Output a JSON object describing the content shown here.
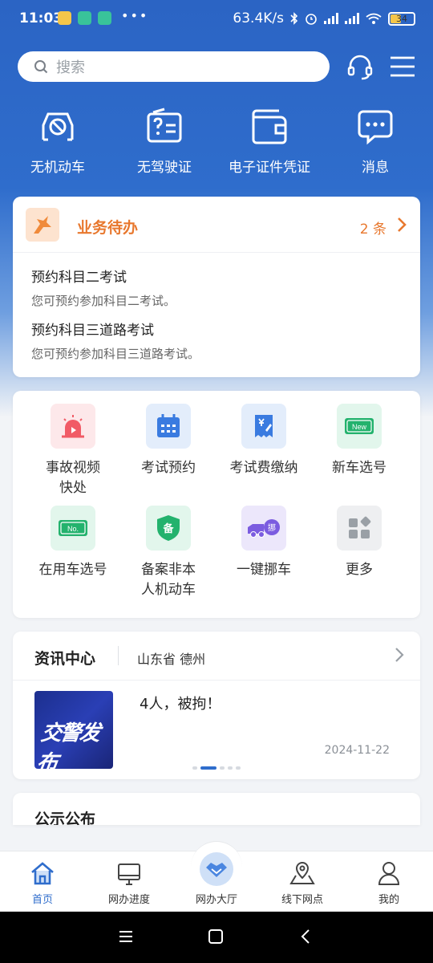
{
  "status_bar": {
    "time": "11:03",
    "more": "•••",
    "net_speed": "63.4K/s",
    "battery": "34"
  },
  "header": {
    "search_placeholder": "搜索"
  },
  "quick_actions": [
    {
      "label": "无机动车",
      "icon": "car-ban-icon"
    },
    {
      "label": "无驾驶证",
      "icon": "license-card-icon"
    },
    {
      "label": "电子证件凭证",
      "icon": "wallet-icon"
    },
    {
      "label": "消息",
      "icon": "message-icon"
    }
  ],
  "todo": {
    "title": "业务待办",
    "count": "2 条",
    "items": [
      {
        "title": "预约科目二考试",
        "desc": "您可预约参加科目二考试。"
      },
      {
        "title": "预约科目三道路考试",
        "desc": "您可预约参加科目三道路考试。"
      }
    ]
  },
  "services": [
    {
      "label": "事故视频\n快处",
      "icon": "siren-video-icon",
      "color": "#fde8ea"
    },
    {
      "label": "考试预约",
      "icon": "calendar-icon",
      "color": "#e3edfb"
    },
    {
      "label": "考试费缴纳",
      "icon": "receipt-yen-icon",
      "color": "#e3edfb"
    },
    {
      "label": "新车选号",
      "icon": "new-plate-icon",
      "color": "#e2f6ec"
    },
    {
      "label": "在用车选号",
      "icon": "no-plate-icon",
      "color": "#e2f6ec"
    },
    {
      "label": "备案非本\n人机动车",
      "icon": "shield-record-icon",
      "color": "#e2f6ec"
    },
    {
      "label": "一键挪车",
      "icon": "tow-truck-icon",
      "color": "#ece7fb"
    },
    {
      "label": "更多",
      "icon": "more-grid-icon",
      "color": "#eeeff1"
    }
  ],
  "news": {
    "heading": "资讯中心",
    "location": "山东省 德州",
    "thumb_text": "交警发布",
    "title": "4人，被拘！",
    "date": "2024-11-22"
  },
  "notice": {
    "heading": "公示公布"
  },
  "tabs": [
    {
      "label": "首页",
      "icon": "home-icon"
    },
    {
      "label": "网办进度",
      "icon": "monitor-icon"
    },
    {
      "label": "网办大厅",
      "icon": "handshake-icon"
    },
    {
      "label": "线下网点",
      "icon": "map-pin-icon"
    },
    {
      "label": "我的",
      "icon": "user-icon"
    }
  ],
  "colors": {
    "brand_blue": "#2f6dcc",
    "accent_orange": "#e8782e"
  }
}
